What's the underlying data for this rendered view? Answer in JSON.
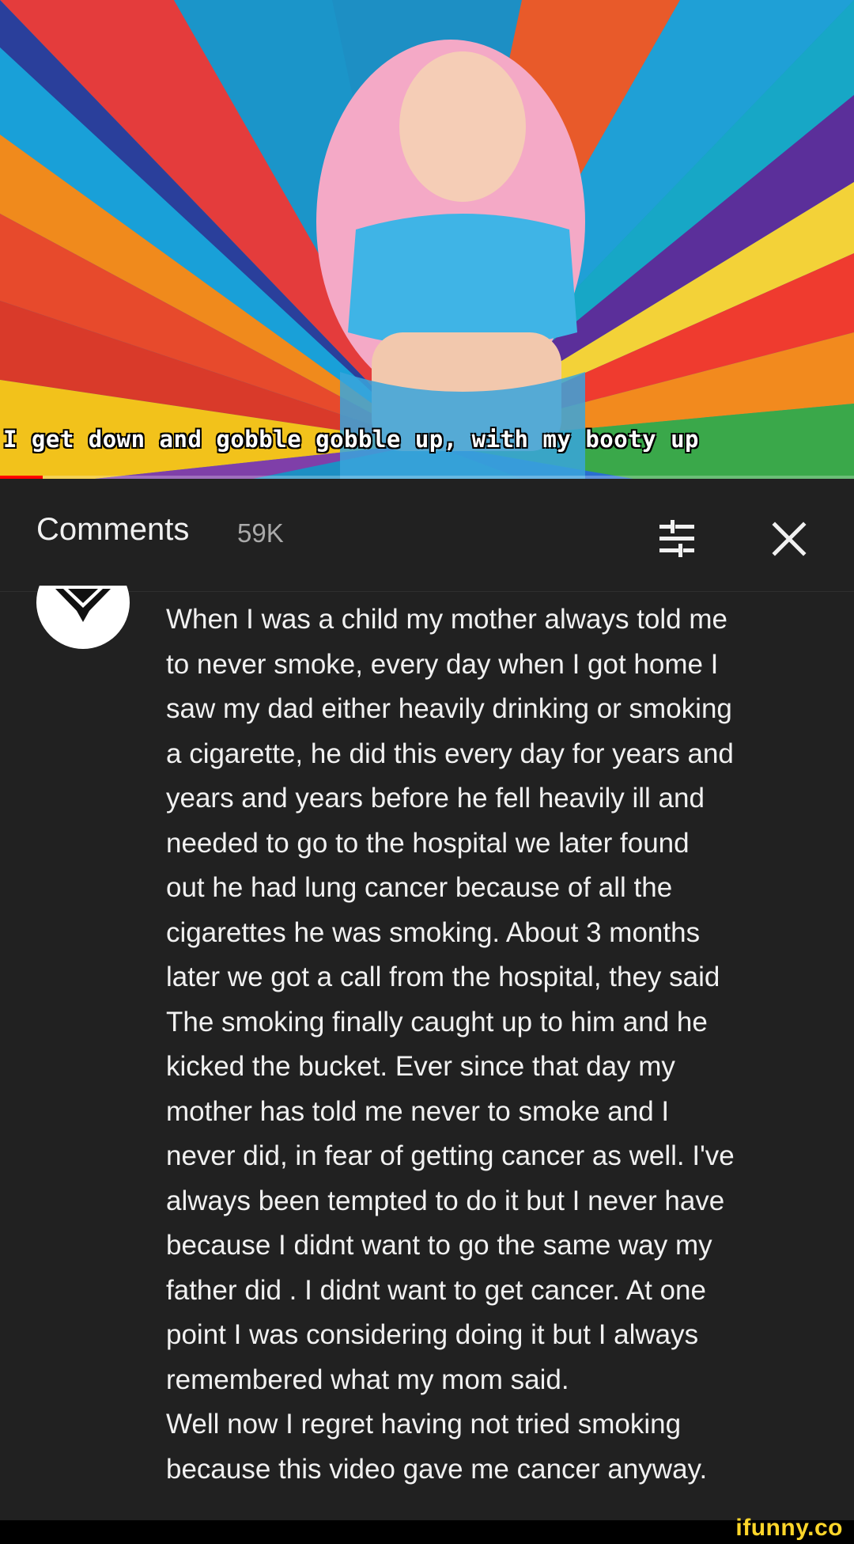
{
  "video": {
    "caption": "I get down and gobble gobble up, with my booty up",
    "progress": 0.05
  },
  "comments_panel": {
    "title": "Comments",
    "count": "59K",
    "sort_icon": "sort-filter-icon",
    "close_icon": "close-icon"
  },
  "comment": {
    "avatar_icon": "emblem-avatar-icon",
    "text": "When I was a child my mother always told me\nto never smoke, every day when I got home I\nsaw my dad either heavily drinking or smoking\na cigarette, he did this every day for years and\nyears and years before he fell heavily ill and\nneeded to go to the hospital we later found\nout he had lung cancer because of all the\ncigarettes he was smoking. About 3 months\nlater we got a call from the hospital, they said\nThe smoking finally caught up to him and he\nkicked the bucket. Ever since that day my\nmother has told me never to smoke and I\nnever did, in fear of getting cancer as well. I've\nalways been tempted to do it but I never have\nbecause I didnt want to go the same way my\nfather did . I didnt want to get cancer. At one\npoint I was considering doing it but I always\nremembered what my mom said.\nWell now I regret having not tried smoking\nbecause this video gave me cancer anyway."
  },
  "watermark": "ifunny.co",
  "colors": {
    "panel_bg": "#212121",
    "text": "#f1f1f1",
    "muted": "#aaaaaa",
    "progress": "#ff0000",
    "watermark": "#ffd62a"
  }
}
